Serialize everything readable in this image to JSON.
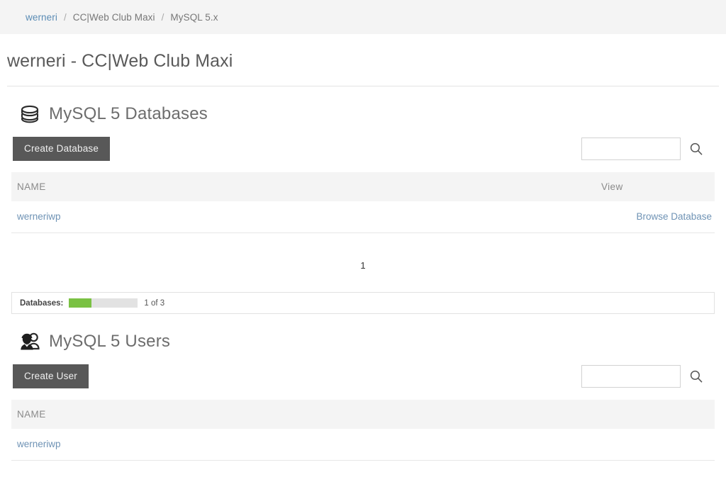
{
  "breadcrumb": {
    "items": [
      {
        "label": "werneri",
        "is_link": true
      },
      {
        "label": "CC|Web Club Maxi",
        "is_link": false
      },
      {
        "label": "MySQL 5.x",
        "is_link": false
      }
    ],
    "separator": "/"
  },
  "page": {
    "title": "werneri - CC|Web Club Maxi"
  },
  "databases_section": {
    "icon": "database-icon",
    "title": "MySQL 5 Databases",
    "create_button": "Create Database",
    "search": {
      "value": "",
      "placeholder": "",
      "icon": "search-icon"
    },
    "table": {
      "headers": [
        "NAME",
        "View"
      ],
      "rows": [
        {
          "name": "werneriwp",
          "view": "Browse Database"
        }
      ]
    },
    "pagination": {
      "current": "1"
    },
    "quota": {
      "label": "Databases:",
      "text": "1 of 3",
      "used": 1,
      "total": 3,
      "percent": 33,
      "fill_color": "#7ac143",
      "track_color": "#e2e2e2"
    }
  },
  "users_section": {
    "icon": "users-icon",
    "title": "MySQL 5 Users",
    "create_button": "Create User",
    "search": {
      "value": "",
      "placeholder": "",
      "icon": "search-icon"
    },
    "table": {
      "headers": [
        "NAME"
      ],
      "rows": [
        {
          "name": "werneriwp"
        }
      ]
    }
  },
  "theme": {
    "link_color": "#6f93b5",
    "button_color": "#585858",
    "header_bg": "#f4f4f4",
    "accent_green": "#7ac143"
  }
}
